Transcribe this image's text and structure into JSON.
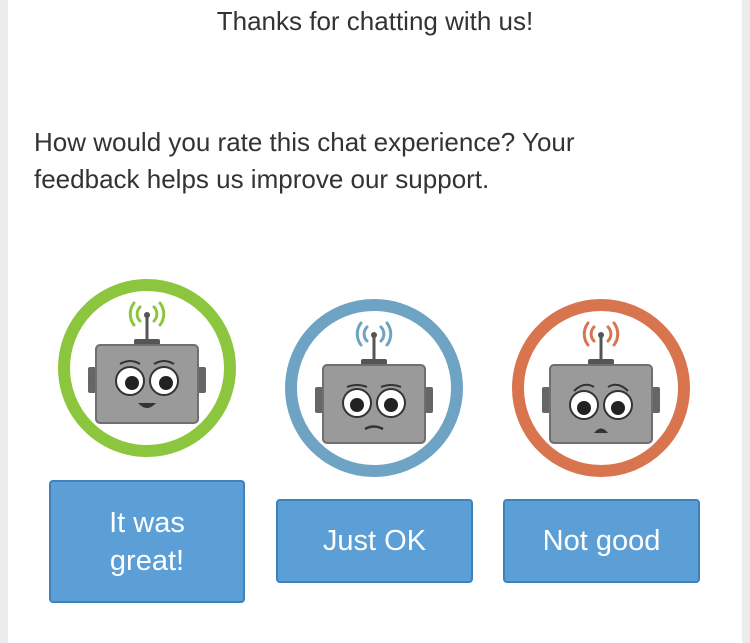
{
  "header": {
    "title": "Thanks for chatting with us!"
  },
  "survey": {
    "question": "How would you rate this chat experience? Your feedback helps us improve our support."
  },
  "options": [
    {
      "id": "great",
      "label": "It was great!",
      "ring_color": "#8cc63f",
      "face_icon": "happy-robot-icon"
    },
    {
      "id": "ok",
      "label": "Just OK",
      "ring_color": "#6fa3c4",
      "face_icon": "neutral-robot-icon"
    },
    {
      "id": "bad",
      "label": "Not good",
      "ring_color": "#d8754e",
      "face_icon": "sad-robot-icon"
    }
  ],
  "colors": {
    "button_bg": "#5b9fd6",
    "button_border": "#3f81bd",
    "button_text": "#ffffff",
    "text": "#333333"
  }
}
